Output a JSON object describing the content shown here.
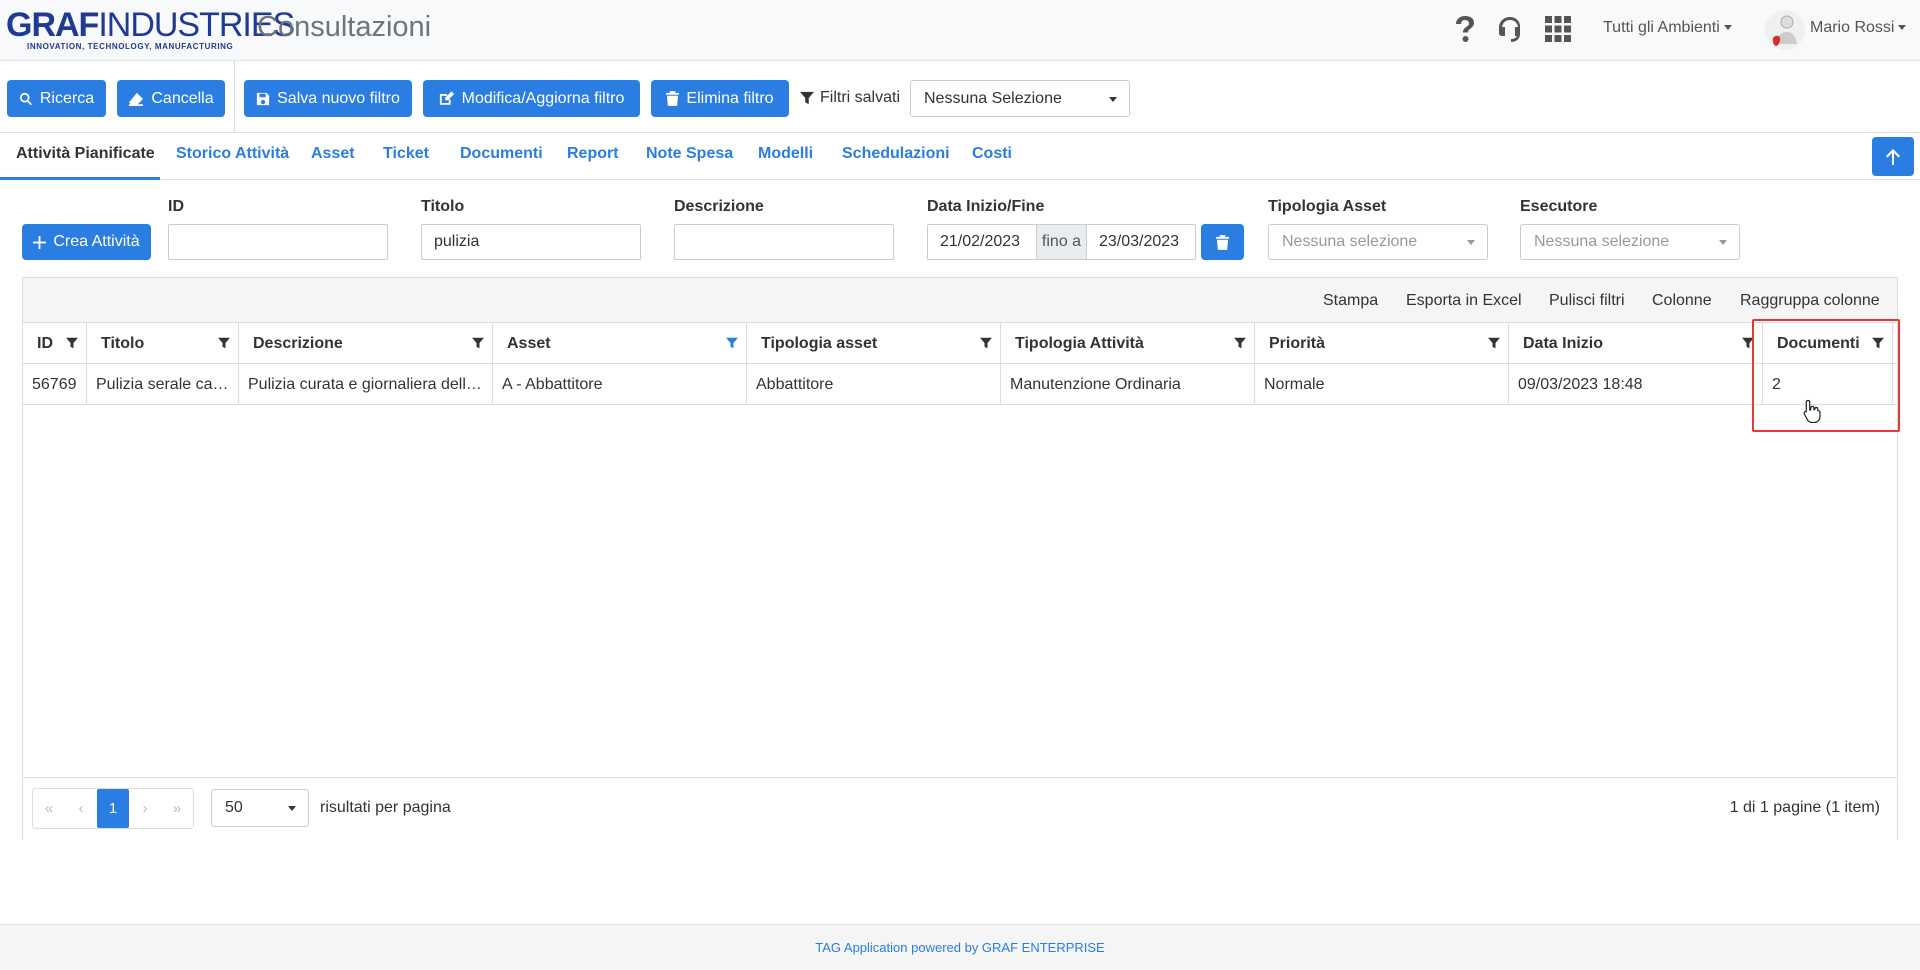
{
  "header": {
    "logo_bold": "GRAF",
    "logo_thin": "INDUSTRIES",
    "logo_tagline": "INNOVATION, TECHNOLOGY, MANUFACTURING",
    "title": "Consultazioni",
    "environments_label": "Tutti gli Ambienti",
    "user_name": "Mario Rossi"
  },
  "toolbar": {
    "search_label": "Ricerca",
    "clear_label": "Cancella",
    "save_filter_label": "Salva nuovo filtro",
    "edit_filter_label": "Modifica/Aggiorna filtro",
    "delete_filter_label": "Elimina filtro",
    "saved_filters_label": "Filtri salvati",
    "saved_filters_value": "Nessuna Selezione"
  },
  "tabs": [
    {
      "label": "Attività Pianificate",
      "active": true
    },
    {
      "label": "Storico Attività"
    },
    {
      "label": "Asset"
    },
    {
      "label": "Ticket"
    },
    {
      "label": "Documenti"
    },
    {
      "label": "Report"
    },
    {
      "label": "Note Spesa"
    },
    {
      "label": "Modelli"
    },
    {
      "label": "Schedulazioni"
    },
    {
      "label": "Costi"
    }
  ],
  "filters": {
    "create_label": "Crea Attività",
    "id_label": "ID",
    "id_value": "",
    "title_label": "Titolo",
    "title_value": "pulizia",
    "description_label": "Descrizione",
    "description_value": "",
    "date_label": "Data Inizio/Fine",
    "date_from": "21/02/2023",
    "date_sep": "fino a",
    "date_to": "23/03/2023",
    "asset_type_label": "Tipologia Asset",
    "asset_type_value": "Nessuna selezione",
    "executor_label": "Esecutore",
    "executor_value": "Nessuna selezione"
  },
  "grid": {
    "toolbar": [
      "Stampa",
      "Esporta in Excel",
      "Pulisci filtri",
      "Colonne",
      "Raggruppa colonne"
    ],
    "columns": [
      "ID",
      "Titolo",
      "Descrizione",
      "Asset",
      "Tipologia asset",
      "Tipologia Attività",
      "Priorità",
      "Data Inizio",
      "Documenti"
    ],
    "rows": [
      [
        "56769",
        "Pulizia serale cabina",
        "Pulizia curata e giornaliera delle superfici",
        "A - Abbattitore",
        "Abbattitore",
        "Manutenzione Ordinaria",
        "Normale",
        "09/03/2023 18:48",
        "2"
      ]
    ],
    "current_page": "1",
    "page_size": "50",
    "page_size_label": "risultati per pagina",
    "page_info": "1 di 1 pagine (1 item)"
  },
  "footer": {
    "text": "TAG Application powered by GRAF ENTERPRISE"
  },
  "colors": {
    "primary": "#2a7de1",
    "highlight": "#e53935"
  }
}
